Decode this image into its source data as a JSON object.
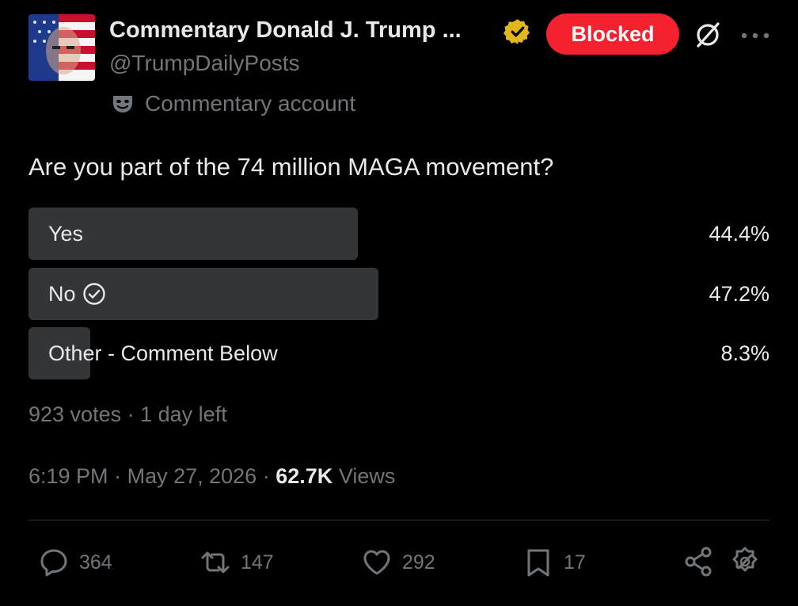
{
  "author": {
    "name": "Commentary Donald J. Trump ...",
    "handle": "@TrumpDailyPosts",
    "account_label": "Commentary account",
    "blocked_label": "Blocked",
    "avatar_icon": "flag-face-avatar",
    "verified_icon": "gold-verified-badge"
  },
  "post": {
    "question": "Are you part of the 74 million MAGA movement?"
  },
  "poll": {
    "options": [
      {
        "label": "Yes",
        "percent": "44.4%",
        "share": 0.444,
        "selected": false
      },
      {
        "label": "No",
        "percent": "47.2%",
        "share": 0.472,
        "selected": true
      },
      {
        "label": "Other - Comment Below",
        "percent": "8.3%",
        "share": 0.083,
        "selected": false
      }
    ],
    "votes": "923 votes",
    "separator": "·",
    "time_left": "1 day left"
  },
  "meta": {
    "time": "6:19 PM",
    "date": "May 27, 2026",
    "views_count": "62.7K",
    "views_label": "Views"
  },
  "actions": {
    "replies": "364",
    "reposts": "147",
    "likes": "292",
    "bookmarks": "17"
  },
  "colors": {
    "background": "#000000",
    "text": "#e7e9ea",
    "muted": "#71767b",
    "poll_fill": "#333639",
    "blocked": "#f4212e",
    "verified": "#e2b719"
  }
}
